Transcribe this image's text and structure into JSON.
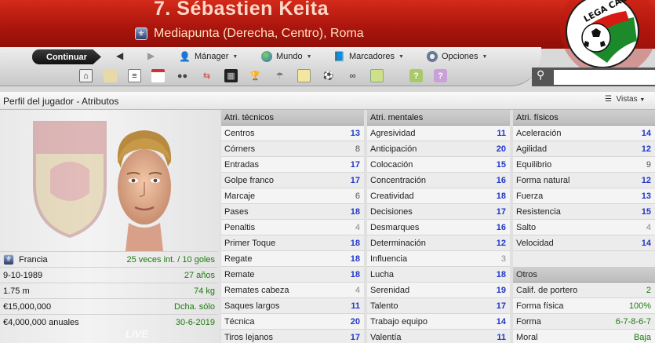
{
  "header": {
    "player_name": "7. Sébastien Keita",
    "position_club": "Mediapunta (Derecha, Centro), Roma"
  },
  "league_logo": {
    "text": "LEGA CALCIO",
    "partial_text": "LE"
  },
  "nav": {
    "continue_label": "Continuar",
    "manager_label": "Mánager",
    "world_label": "Mundo",
    "bookmarks_label": "Marcadores",
    "options_label": "Opciones"
  },
  "toolbar_icons": [
    "home-icon",
    "bread-icon",
    "notebook-icon",
    "calendar-icon",
    "people-icon",
    "transfer-icon",
    "tactics-board-icon",
    "trophy-icon",
    "scout-icon",
    "clipboard-icon",
    "ball-boot-icon",
    "binoculars-icon",
    "money-icon",
    "help-icon",
    "question-icon"
  ],
  "search": {
    "placeholder": ""
  },
  "page": {
    "title": "Perfil del jugador - Atributos",
    "views_label": "Vistas"
  },
  "player_info": [
    {
      "label": "Francia",
      "value": "25 veces int. / 10 goles"
    },
    {
      "label": "9-10-1989",
      "value": "27 años"
    },
    {
      "label": "1.75 m",
      "value": "74 kg"
    },
    {
      "label": "€15,000,000",
      "value": "Dcha. sólo"
    },
    {
      "label": "€4,000,000 anuales",
      "value": "30-6-2019"
    }
  ],
  "watermark": "LIVE",
  "technical": {
    "title": "Atri. técnicos",
    "rows": [
      {
        "name": "Centros",
        "value": "13"
      },
      {
        "name": "Córners",
        "value": "8"
      },
      {
        "name": "Entradas",
        "value": "17"
      },
      {
        "name": "Golpe franco",
        "value": "17"
      },
      {
        "name": "Marcaje",
        "value": "6"
      },
      {
        "name": "Pases",
        "value": "18"
      },
      {
        "name": "Penaltis",
        "value": "4"
      },
      {
        "name": "Primer Toque",
        "value": "18"
      },
      {
        "name": "Regate",
        "value": "18"
      },
      {
        "name": "Remate",
        "value": "18"
      },
      {
        "name": "Remates cabeza",
        "value": "4"
      },
      {
        "name": "Saques largos",
        "value": "11"
      },
      {
        "name": "Técnica",
        "value": "20"
      },
      {
        "name": "Tiros lejanos",
        "value": "17"
      }
    ]
  },
  "mental": {
    "title": "Atri. mentales",
    "rows": [
      {
        "name": "Agresividad",
        "value": "11"
      },
      {
        "name": "Anticipación",
        "value": "20"
      },
      {
        "name": "Colocación",
        "value": "15"
      },
      {
        "name": "Concentración",
        "value": "16"
      },
      {
        "name": "Creatividad",
        "value": "18"
      },
      {
        "name": "Decisiones",
        "value": "17"
      },
      {
        "name": "Desmarques",
        "value": "16"
      },
      {
        "name": "Determinación",
        "value": "12"
      },
      {
        "name": "Influencia",
        "value": "3"
      },
      {
        "name": "Lucha",
        "value": "18"
      },
      {
        "name": "Serenidad",
        "value": "19"
      },
      {
        "name": "Talento",
        "value": "17"
      },
      {
        "name": "Trabajo equipo",
        "value": "14"
      },
      {
        "name": "Valentía",
        "value": "11"
      }
    ]
  },
  "physical": {
    "title": "Atri. físicos",
    "rows": [
      {
        "name": "Aceleración",
        "value": "14"
      },
      {
        "name": "Agilidad",
        "value": "12"
      },
      {
        "name": "Equilibrio",
        "value": "9"
      },
      {
        "name": "Forma natural",
        "value": "12"
      },
      {
        "name": "Fuerza",
        "value": "13"
      },
      {
        "name": "Resistencia",
        "value": "15"
      },
      {
        "name": "Salto",
        "value": "4"
      },
      {
        "name": "Velocidad",
        "value": "14"
      }
    ]
  },
  "others": {
    "title": "Otros",
    "rows": [
      {
        "name": "Calif. de portero",
        "value": "2"
      },
      {
        "name": "Forma física",
        "value": "100%"
      },
      {
        "name": "Forma",
        "value": "6-7-8-6-7"
      },
      {
        "name": "Moral",
        "value": "Baja"
      }
    ]
  },
  "colors": {
    "header_red": "#b81a10",
    "attr_high": "#2038c8",
    "attr_low": "#888888",
    "info_green": "#1e7a10"
  }
}
